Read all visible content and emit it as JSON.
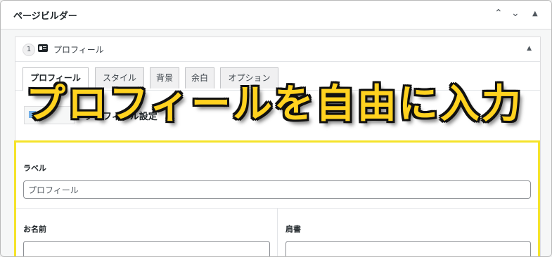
{
  "postbox": {
    "title": "ページビルダー",
    "controls": {
      "up": "⌃",
      "down": "⌄",
      "toggle": "▲"
    }
  },
  "item": {
    "number": "1",
    "icon": "id-card-icon",
    "title": "プロフィール",
    "toggle": "▲",
    "tabs": [
      {
        "label": "プロフィール",
        "active": true
      },
      {
        "label": "スタイル"
      },
      {
        "label": "背景"
      },
      {
        "label": "余白"
      },
      {
        "label": "オプション"
      }
    ],
    "sub_label": "プロフィール設定"
  },
  "fields": {
    "label": {
      "label": "ラベル",
      "value": "プロフィール"
    },
    "name": {
      "label": "お名前",
      "value": ""
    },
    "title": {
      "label": "肩書",
      "value": ""
    }
  },
  "banner": {
    "text": "プロフィールを自由に入力",
    "color": "#ffd21f"
  },
  "colors": {
    "highlight": "#f5e32a",
    "accent": "#72aee6"
  }
}
